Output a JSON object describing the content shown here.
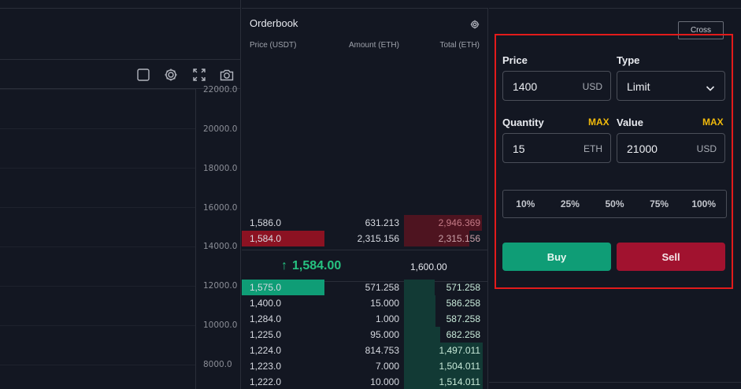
{
  "chart": {
    "price_axis": [
      "22000.0",
      "20000.0",
      "18000.0",
      "16000.0",
      "14000.0",
      "12000.0",
      "10000.0",
      "8000.0"
    ],
    "toolbar_icons": [
      "square-icon",
      "gear-icon",
      "fullscreen-icon",
      "camera-icon"
    ]
  },
  "orderbook": {
    "title": "Orderbook",
    "headers": {
      "price": "Price (USDT)",
      "amount": "Amount (ETH)",
      "total": "Total (ETH)"
    },
    "asks": [
      {
        "price": "1,586.0",
        "amount": "631.213",
        "total": "2,946.369"
      },
      {
        "price": "1,584.0",
        "amount": "2,315.156",
        "total": "2,315.156"
      }
    ],
    "spread": {
      "arrow": "↑",
      "last_price": "1,584.00",
      "mark_price": "1,600.00"
    },
    "bids": [
      {
        "price": "1,575.0",
        "amount": "571.258",
        "total": "571.258"
      },
      {
        "price": "1,400.0",
        "amount": "15.000",
        "total": "586.258"
      },
      {
        "price": "1,284.0",
        "amount": "1.000",
        "total": "587.258"
      },
      {
        "price": "1,225.0",
        "amount": "95.000",
        "total": "682.258"
      },
      {
        "price": "1,224.0",
        "amount": "814.753",
        "total": "1,497.011"
      },
      {
        "price": "1,223.0",
        "amount": "7.000",
        "total": "1,504.011"
      },
      {
        "price": "1,222.0",
        "amount": "10.000",
        "total": "1,514.011"
      }
    ],
    "colors": {
      "ask": "#a1122f",
      "bid": "#0f9d76",
      "up": "#26c281"
    }
  },
  "trade": {
    "margin_mode": "Cross",
    "price_label": "Price",
    "price_value": "1400",
    "price_unit": "USD",
    "type_label": "Type",
    "type_value": "Limit",
    "quantity_label": "Quantity",
    "quantity_max": "MAX",
    "quantity_value": "15",
    "quantity_unit": "ETH",
    "value_label": "Value",
    "value_max": "MAX",
    "value_value": "21000",
    "value_unit": "USD",
    "percentages": [
      "10%",
      "25%",
      "50%",
      "75%",
      "100%"
    ],
    "buy_label": "Buy",
    "sell_label": "Sell",
    "colors": {
      "buy": "#0f9d76",
      "sell": "#a1122f",
      "max": "#f0b90b",
      "highlight_frame": "#e21b1b"
    }
  }
}
